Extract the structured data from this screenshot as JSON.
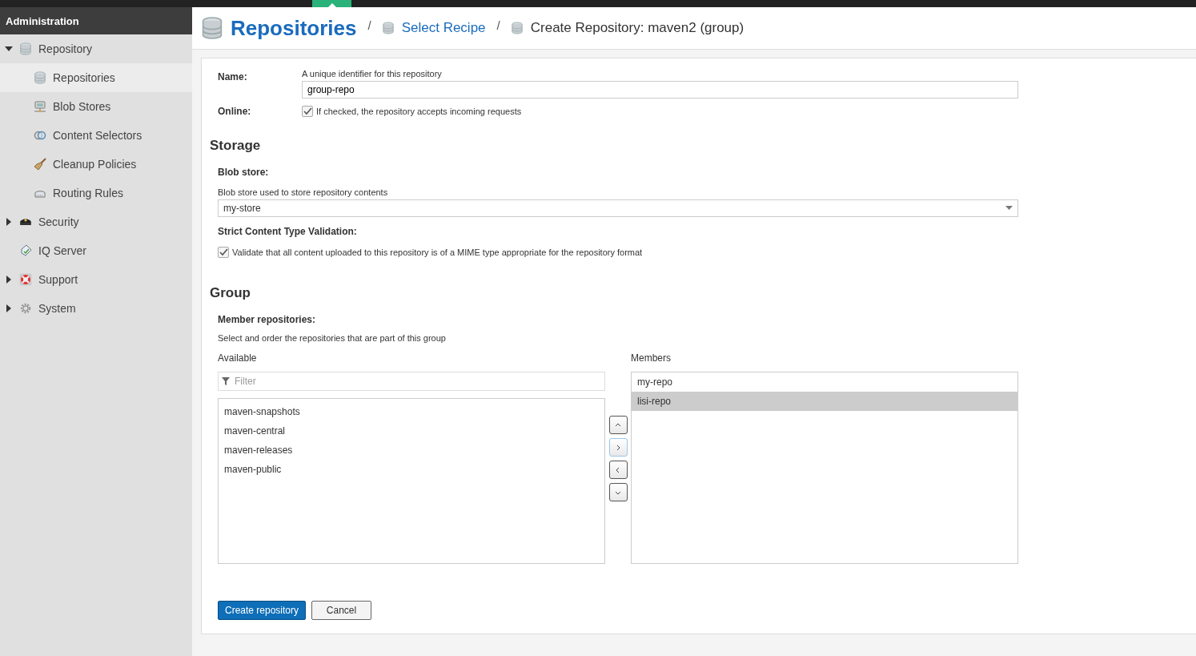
{
  "sidebar": {
    "title": "Administration",
    "items": [
      {
        "label": "Repository",
        "expanded": true,
        "selected": false,
        "children": [
          {
            "label": "Repositories",
            "selected": true
          },
          {
            "label": "Blob Stores",
            "selected": false
          },
          {
            "label": "Content Selectors",
            "selected": false
          },
          {
            "label": "Cleanup Policies",
            "selected": false
          },
          {
            "label": "Routing Rules",
            "selected": false
          }
        ]
      },
      {
        "label": "Security",
        "expanded": false,
        "selected": false
      },
      {
        "label": "IQ Server",
        "selected": false
      },
      {
        "label": "Support",
        "expanded": false,
        "selected": false
      },
      {
        "label": "System",
        "expanded": false,
        "selected": false
      }
    ]
  },
  "breadcrumb": [
    {
      "label": "Repositories",
      "kind": "root"
    },
    {
      "label": "Select Recipe",
      "kind": "link"
    },
    {
      "label": "Create Repository: maven2 (group)",
      "kind": "current"
    }
  ],
  "separator": "/",
  "form": {
    "name": {
      "label": "Name:",
      "help": "A unique identifier for this repository",
      "value": "group-repo"
    },
    "online": {
      "label": "Online:",
      "text": "If checked, the repository accepts incoming requests",
      "checked": true
    },
    "storage": {
      "heading": "Storage",
      "blob_label": "Blob store:",
      "blob_help": "Blob store used to store repository contents",
      "blob_value": "my-store",
      "strict_label": "Strict Content Type Validation:",
      "strict_text": "Validate that all content uploaded to this repository is of a MIME type appropriate for the repository format",
      "strict_checked": true
    },
    "group": {
      "heading": "Group",
      "members_label": "Member repositories:",
      "members_help": "Select and order the repositories that are part of this group",
      "available_label": "Available",
      "filter_placeholder": "Filter",
      "available": [
        {
          "label": "maven-snapshots",
          "selected": false
        },
        {
          "label": "maven-central",
          "selected": false
        },
        {
          "label": "maven-releases",
          "selected": false
        },
        {
          "label": "maven-public",
          "selected": false
        }
      ],
      "move_buttons": [
        {
          "kind": "up",
          "focused": false
        },
        {
          "kind": "right",
          "focused": true
        },
        {
          "kind": "left",
          "focused": false
        },
        {
          "kind": "down",
          "focused": false
        }
      ],
      "members_title": "Members",
      "members": [
        {
          "label": "my-repo",
          "selected": false
        },
        {
          "label": "lisi-repo",
          "selected": true
        }
      ]
    }
  },
  "buttons": [
    {
      "label": "Create repository",
      "kind": "primary"
    },
    {
      "label": "Cancel",
      "kind": "secondary"
    }
  ]
}
